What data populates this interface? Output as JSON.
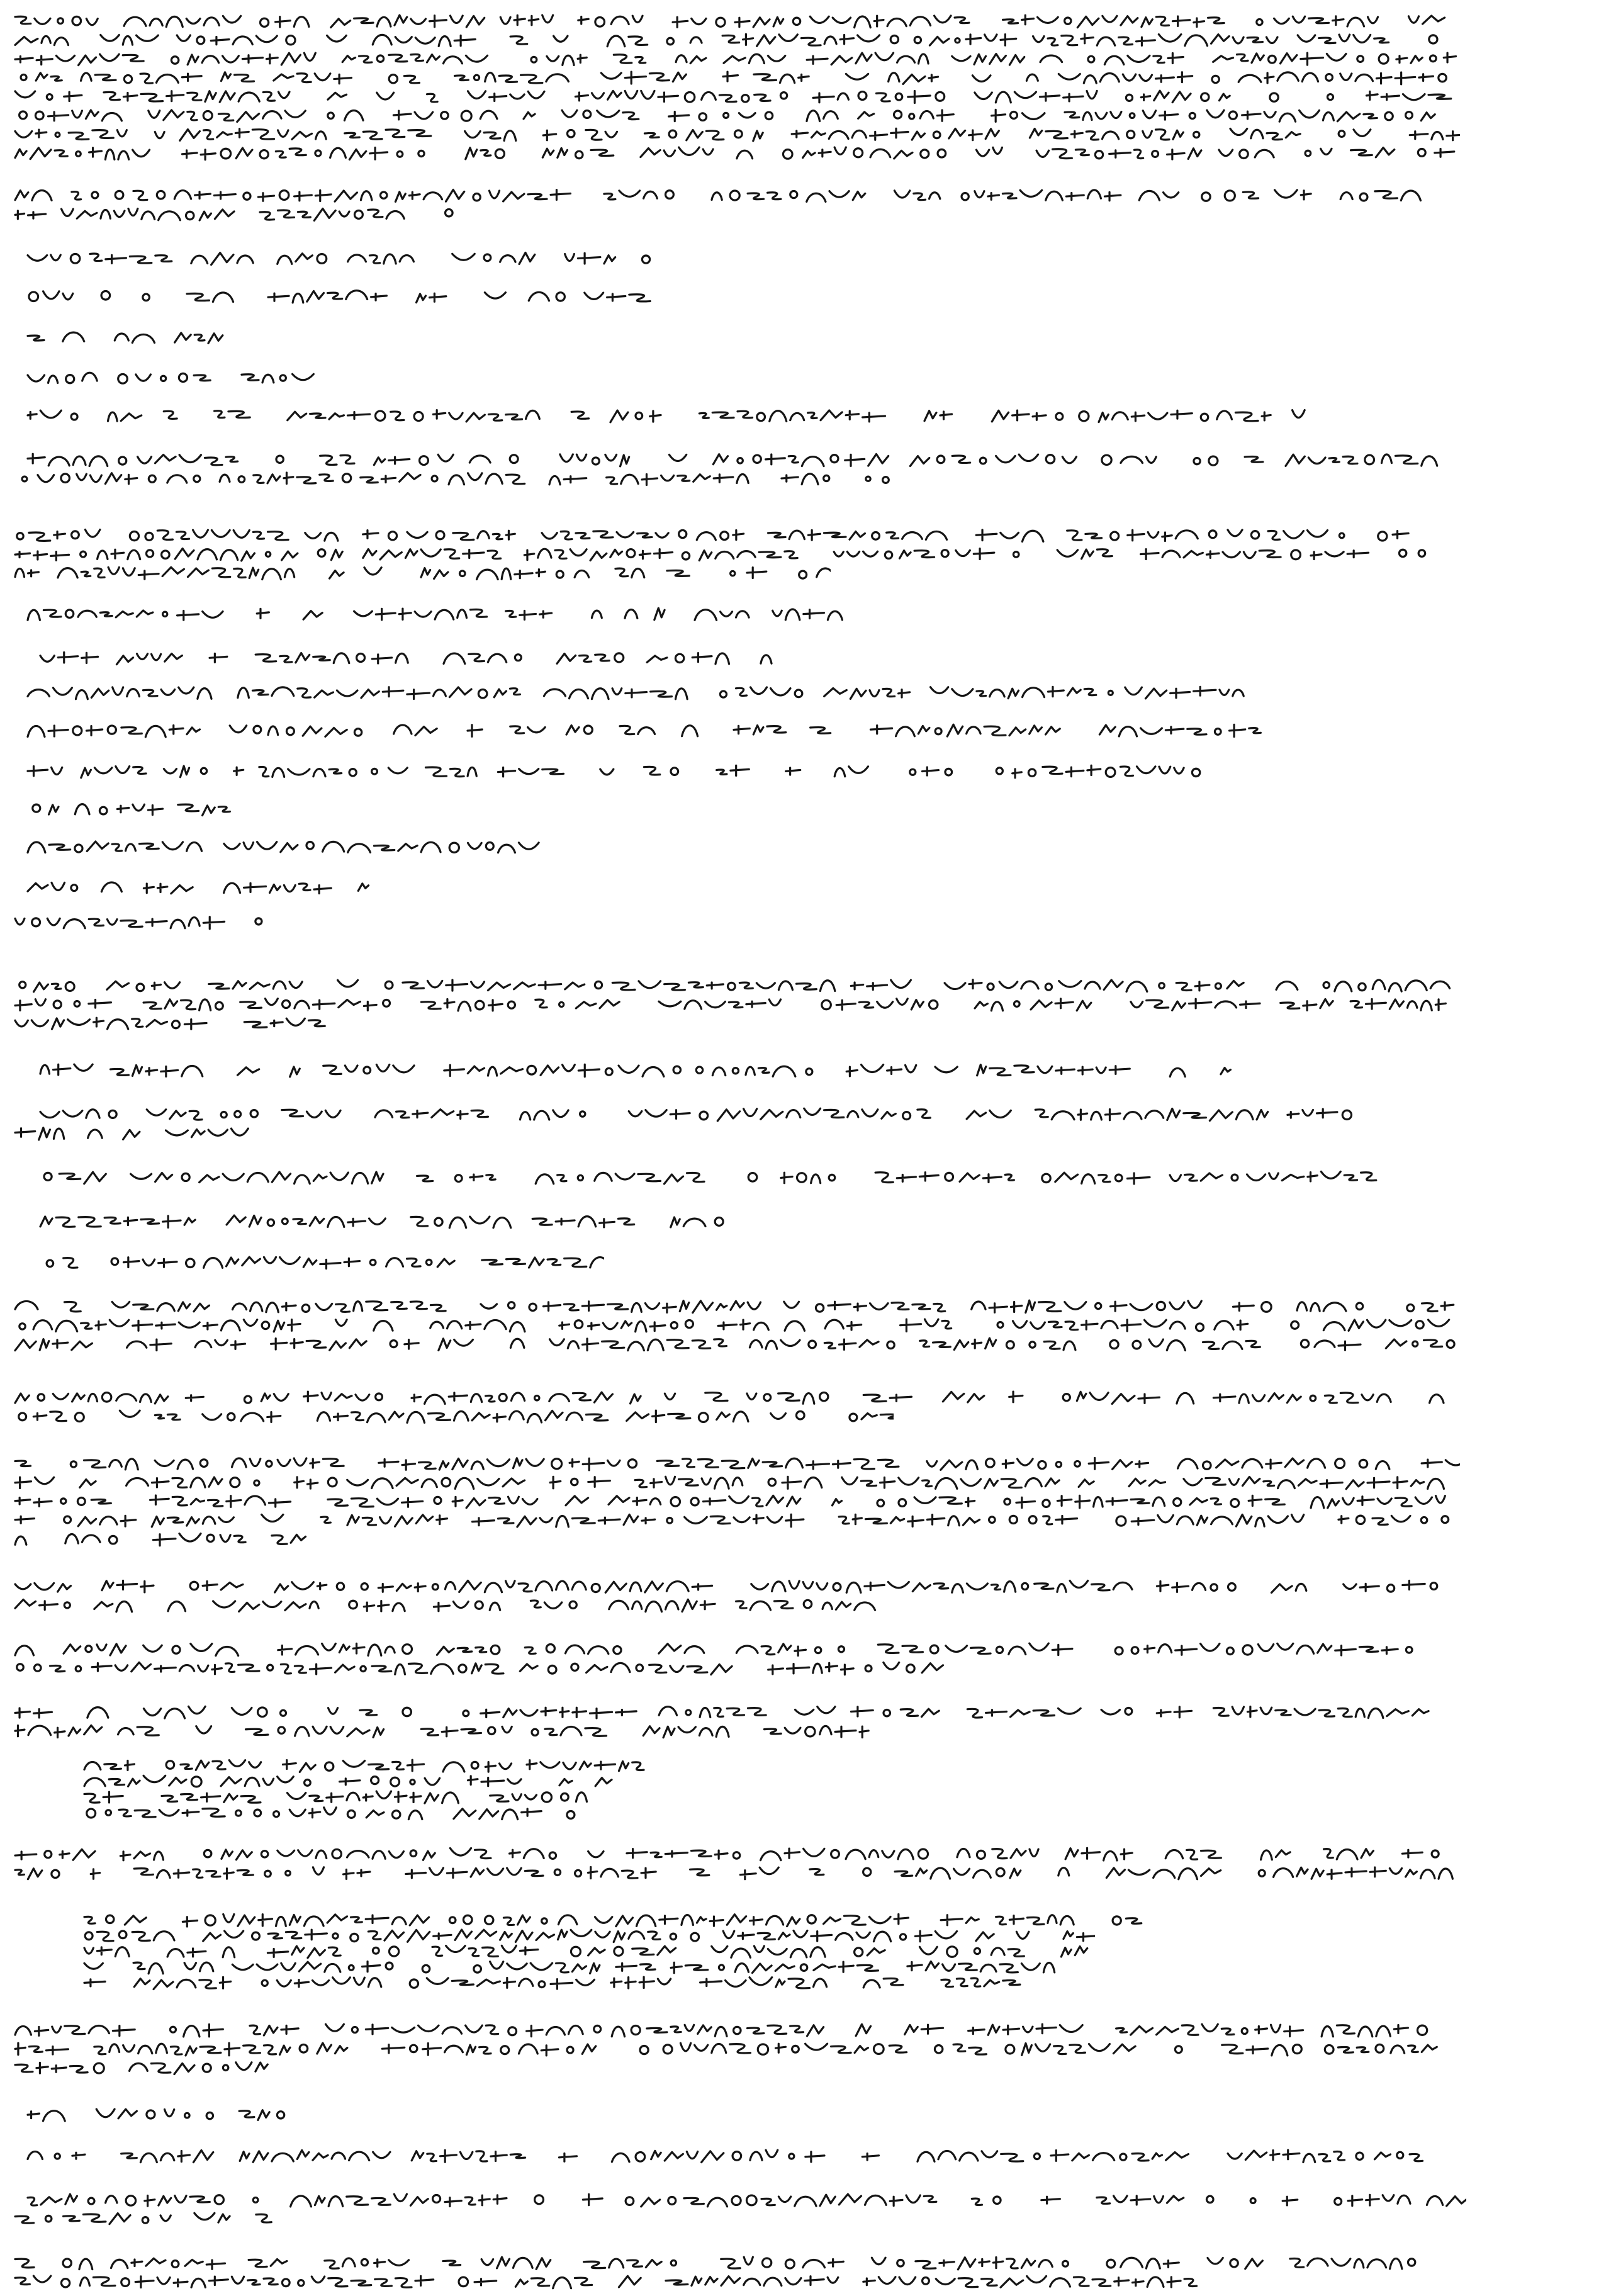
{
  "document": {
    "kind": "handwritten-manuscript-page",
    "script": "illegible",
    "ink_color": "#151515",
    "background": "#ffffff",
    "blocks": [
      {
        "id": "para-1",
        "lines": 8,
        "indent": "none"
      },
      {
        "id": "para-2",
        "lines": 2,
        "indent": "none"
      },
      {
        "id": "list-1",
        "lines": 12,
        "indent": "small"
      },
      {
        "id": "para-3",
        "lines": 3,
        "indent": "none"
      },
      {
        "id": "list-2",
        "lines": 5,
        "indent": "medium"
      },
      {
        "id": "para-4",
        "lines": 4,
        "indent": "none"
      },
      {
        "id": "para-5",
        "lines": 2,
        "indent": "none"
      },
      {
        "id": "para-6",
        "lines": 5,
        "indent": "none"
      },
      {
        "id": "para-7",
        "lines": 2,
        "indent": "none"
      },
      {
        "id": "para-8",
        "lines": 2,
        "indent": "none"
      },
      {
        "id": "para-9",
        "lines": 2,
        "indent": "none"
      },
      {
        "id": "verse-1",
        "lines": 4,
        "indent": "large"
      },
      {
        "id": "para-10",
        "lines": 2,
        "indent": "none"
      },
      {
        "id": "verse-2",
        "lines": 5,
        "indent": "large"
      },
      {
        "id": "para-11",
        "lines": 3,
        "indent": "none"
      },
      {
        "id": "list-3",
        "lines": 7,
        "indent": "small"
      }
    ]
  }
}
